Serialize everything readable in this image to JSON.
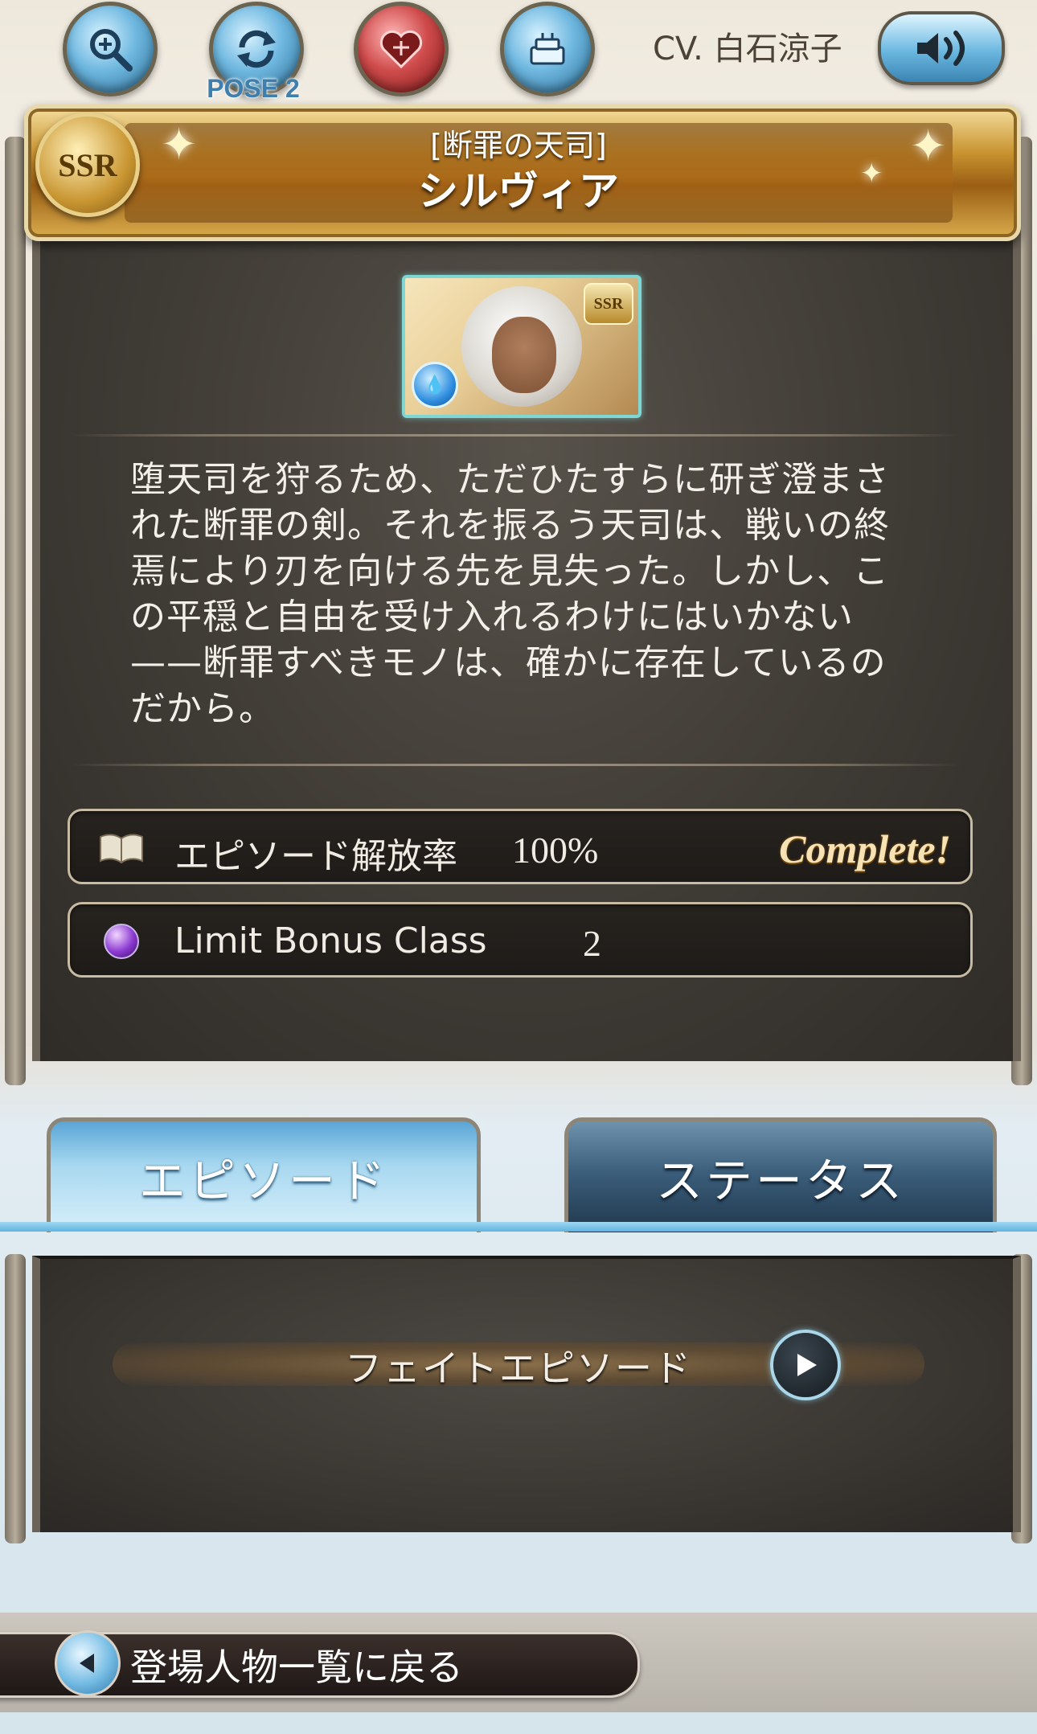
{
  "header": {
    "cv_label": "CV. 白石涼子",
    "pose_label": "POSE 2",
    "icons": [
      "zoom-icon",
      "pose-switch-icon",
      "valentine-voice-icon",
      "birthday-voice-icon",
      "sound-icon"
    ]
  },
  "character": {
    "rarity": "SSR",
    "subtitle": "[断罪の天司]",
    "name": "シルヴィア",
    "element": "water",
    "description": "堕天司を狩るため、ただひたすらに研ぎ澄まされた断罪の剣。それを振るう天司は、戦いの終焉により刃を向ける先を見失った。しかし、この平穏と自由を受け入れるわけにはいかない——断罪すべきモノは、確かに存在しているのだから。"
  },
  "info": {
    "episode_label": "エピソード解放率",
    "episode_value": "100%",
    "complete_badge": "Complete!",
    "limit_label": "Limit Bonus Class",
    "limit_value": "2"
  },
  "tabs": {
    "episode": "エピソード",
    "status": "ステータス"
  },
  "episodes": {
    "fate_label": "フェイトエピソード"
  },
  "footer": {
    "back_label": "登場人物一覧に戻る"
  }
}
